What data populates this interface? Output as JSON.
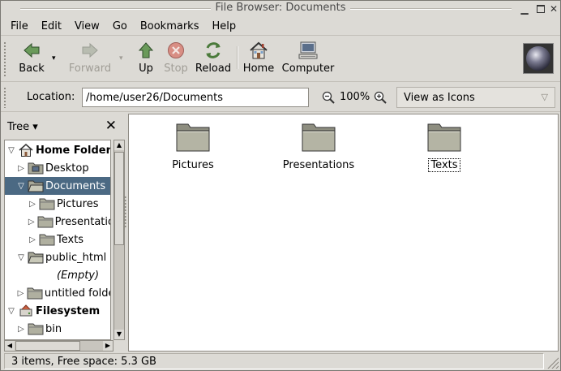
{
  "window": {
    "title": "File Browser: Documents",
    "minimize_glyph": "▁",
    "close_glyph": "✕"
  },
  "menubar": {
    "items": [
      {
        "label": "File"
      },
      {
        "label": "Edit"
      },
      {
        "label": "View"
      },
      {
        "label": "Go"
      },
      {
        "label": "Bookmarks"
      },
      {
        "label": "Help"
      }
    ]
  },
  "toolbar": {
    "back": {
      "label": "Back",
      "icon": "back-arrow-icon",
      "enabled": true
    },
    "forward": {
      "label": "Forward",
      "icon": "forward-arrow-icon",
      "enabled": false
    },
    "up": {
      "label": "Up",
      "icon": "up-arrow-icon",
      "enabled": true
    },
    "stop": {
      "label": "Stop",
      "icon": "stop-icon",
      "enabled": false
    },
    "reload": {
      "label": "Reload",
      "icon": "reload-icon",
      "enabled": true
    },
    "home": {
      "label": "Home",
      "icon": "home-icon",
      "enabled": true
    },
    "computer": {
      "label": "Computer",
      "icon": "computer-icon",
      "enabled": true
    },
    "dropdown_glyph": "▾"
  },
  "location": {
    "label": "Location:",
    "value": "/home/user26/Documents",
    "zoom": "100%",
    "view_mode": "View as Icons",
    "view_arrow": "▽"
  },
  "sidebar": {
    "title": "Tree ▾",
    "close": "✕",
    "items": [
      {
        "label": "Home Folder",
        "exp": "▽",
        "icon": "home-icon",
        "bold": true
      },
      {
        "label": "Desktop",
        "exp": "▷",
        "icon": "desktop-folder-icon"
      },
      {
        "label": "Documents",
        "exp": "▽",
        "icon": "folder-open-icon",
        "selected": true
      },
      {
        "label": "Pictures",
        "exp": "▷",
        "icon": "folder-icon"
      },
      {
        "label": "Presentations",
        "exp": "▷",
        "icon": "folder-icon"
      },
      {
        "label": "Texts",
        "exp": "▷",
        "icon": "folder-icon"
      },
      {
        "label": "public_html",
        "exp": "▽",
        "icon": "folder-open-icon"
      },
      {
        "label": "(Empty)",
        "exp": "",
        "icon": "",
        "italic": true
      },
      {
        "label": "untitled folder",
        "exp": "▷",
        "icon": "folder-icon"
      },
      {
        "label": "Filesystem",
        "exp": "▽",
        "icon": "filesystem-icon",
        "bold": true
      },
      {
        "label": "bin",
        "exp": "▷",
        "icon": "folder-icon"
      }
    ]
  },
  "files": [
    {
      "name": "Pictures",
      "icon": "folder-icon"
    },
    {
      "name": "Presentations",
      "icon": "folder-icon"
    },
    {
      "name": "Texts",
      "icon": "folder-icon",
      "focused": true
    }
  ],
  "status": {
    "text": "3 items, Free space: 5.3 GB"
  },
  "colors": {
    "selection": "#4b6983",
    "window_bg": "#dcdad5"
  }
}
